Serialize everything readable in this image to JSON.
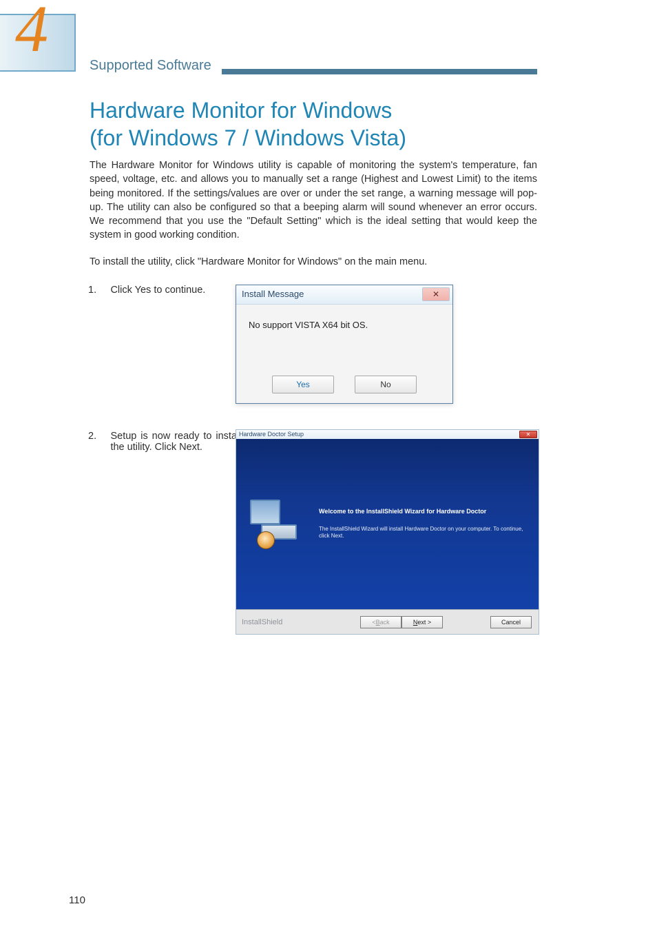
{
  "chapter": {
    "number": "4",
    "section_title": "Supported Software"
  },
  "heading": {
    "line1": "Hardware Monitor for Windows",
    "line2": "(for Windows 7 / Windows Vista)"
  },
  "paragraphs": {
    "p1": "The Hardware Monitor for Windows utility is capable of monitoring the system's temperature, fan speed, voltage, etc. and allows you to manually set a range (Highest and Lowest Limit) to the items being monitored. If the settings/values are over or under the set range, a warning message will pop-up. The utility can also be configured so that a beeping alarm will sound whenever an error occurs. We recommend that you use the \"Default Setting\" which is the ideal setting that would keep the system in good working condition.",
    "p2": "To install the utility, click \"Hardware Monitor for Windows\" on the main menu."
  },
  "steps": {
    "s1": {
      "num": "1.",
      "text": "Click Yes to continue."
    },
    "s2": {
      "num": "2.",
      "text": "Setup is now ready to install the utility. Click Next."
    }
  },
  "dialog1": {
    "title": "Install Message",
    "close_glyph": "✕",
    "message": "No support VISTA X64 bit OS.",
    "yes_label": "Yes",
    "no_label": "No"
  },
  "dialog2": {
    "title": "Hardware Doctor Setup",
    "close_glyph": "✕",
    "welcome": "Welcome to the InstallShield Wizard for Hardware Doctor",
    "subtitle": "The InstallShield Wizard will install Hardware Doctor on your computer.  To continue, click Next.",
    "brand": "InstallShield",
    "back_label_pre": "< ",
    "back_label_u": "B",
    "back_label_post": "ack",
    "next_label_u": "N",
    "next_label_post": "ext >",
    "cancel_label": "Cancel"
  },
  "page_number": "110"
}
